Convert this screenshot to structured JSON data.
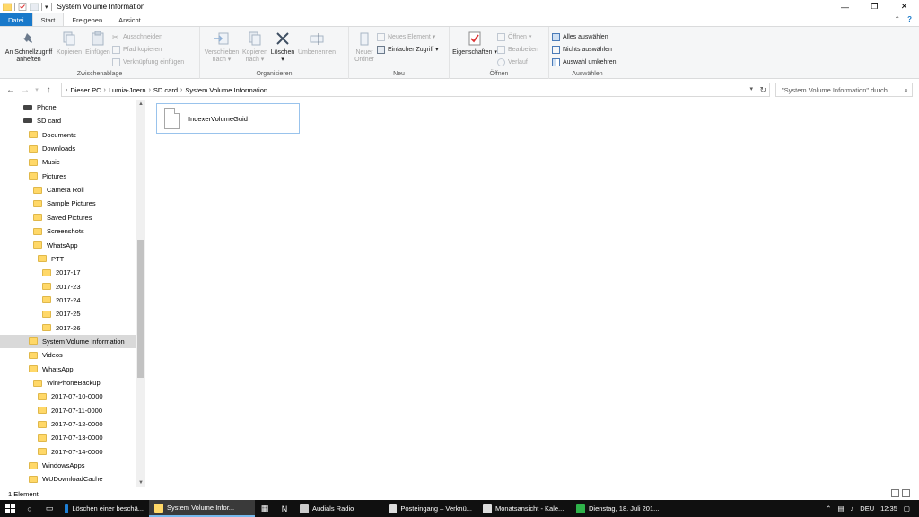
{
  "window": {
    "title": "System Volume Information",
    "min": "—",
    "max": "❐",
    "close": "✕"
  },
  "tabs": [
    "Datei",
    "Start",
    "Freigeben",
    "Ansicht"
  ],
  "ribbon": {
    "clipboard": {
      "pin": "An Schnellzugriff anheften",
      "copy": "Kopieren",
      "paste": "Einfügen",
      "cut": "Ausschneiden",
      "copy_path": "Pfad kopieren",
      "paste_shortcut": "Verknüpfung einfügen",
      "label": "Zwischenablage"
    },
    "organize": {
      "move": "Verschieben nach ▾",
      "copy_to": "Kopieren nach ▾",
      "delete": "Löschen ▾",
      "rename": "Umbenennen",
      "label": "Organisieren"
    },
    "new": {
      "new_folder": "Neuer Ordner",
      "new_item": "Neues Element ▾",
      "easy_access": "Einfacher Zugriff ▾",
      "label": "Neu"
    },
    "open": {
      "properties": "Eigenschaften ▾",
      "open": "Öffnen ▾",
      "edit": "Bearbeiten",
      "history": "Verlauf",
      "label": "Öffnen"
    },
    "select": {
      "select_all": "Alles auswählen",
      "select_none": "Nichts auswählen",
      "invert": "Auswahl umkehren",
      "label": "Auswählen"
    }
  },
  "address": {
    "crumbs": [
      "Dieser PC",
      "Lumia-Joern",
      "SD card",
      "System Volume Information"
    ],
    "search_placeholder": "\"System Volume Information\" durch..."
  },
  "nav": [
    {
      "label": "Phone",
      "type": "device",
      "indent": 26
    },
    {
      "label": "SD card",
      "type": "device",
      "indent": 26
    },
    {
      "label": "Documents",
      "type": "folder",
      "indent": 32
    },
    {
      "label": "Downloads",
      "type": "folder",
      "indent": 32
    },
    {
      "label": "Music",
      "type": "folder",
      "indent": 32
    },
    {
      "label": "Pictures",
      "type": "folder",
      "indent": 32
    },
    {
      "label": "Camera Roll",
      "type": "folder",
      "indent": 37
    },
    {
      "label": "Sample Pictures",
      "type": "folder",
      "indent": 37
    },
    {
      "label": "Saved Pictures",
      "type": "folder",
      "indent": 37
    },
    {
      "label": "Screenshots",
      "type": "folder",
      "indent": 37
    },
    {
      "label": "WhatsApp",
      "type": "folder",
      "indent": 37
    },
    {
      "label": "PTT",
      "type": "folder",
      "indent": 42
    },
    {
      "label": "2017-17",
      "type": "folder",
      "indent": 47
    },
    {
      "label": "2017-23",
      "type": "folder",
      "indent": 47
    },
    {
      "label": "2017-24",
      "type": "folder",
      "indent": 47
    },
    {
      "label": "2017-25",
      "type": "folder",
      "indent": 47
    },
    {
      "label": "2017-26",
      "type": "folder",
      "indent": 47
    },
    {
      "label": "System Volume Information",
      "type": "folder",
      "indent": 32,
      "selected": true
    },
    {
      "label": "Videos",
      "type": "folder",
      "indent": 32
    },
    {
      "label": "WhatsApp",
      "type": "folder",
      "indent": 32
    },
    {
      "label": "WinPhoneBackup",
      "type": "folder",
      "indent": 37
    },
    {
      "label": "2017-07-10-0000",
      "type": "folder",
      "indent": 42
    },
    {
      "label": "2017-07-11-0000",
      "type": "folder",
      "indent": 42
    },
    {
      "label": "2017-07-12-0000",
      "type": "folder",
      "indent": 42
    },
    {
      "label": "2017-07-13-0000",
      "type": "folder",
      "indent": 42
    },
    {
      "label": "2017-07-14-0000",
      "type": "folder",
      "indent": 42
    },
    {
      "label": "WindowsApps",
      "type": "folder",
      "indent": 32
    },
    {
      "label": "WUDownloadCache",
      "type": "folder",
      "indent": 32
    }
  ],
  "files": [
    {
      "name": "IndexerVolumeGuid"
    }
  ],
  "status": {
    "count": "1 Element"
  },
  "taskbar": {
    "apps": [
      {
        "label": "Löschen einer beschä...",
        "color": "#1e7fd6"
      },
      {
        "label": "System Volume Infor...",
        "color": "#ffd868",
        "active": true
      },
      {
        "label": "Audials Radio",
        "color": "#cccccc"
      },
      {
        "label": "Posteingang – Verknü...",
        "color": "#dddddd"
      },
      {
        "label": "Monatsansicht - Kale...",
        "color": "#dddddd"
      },
      {
        "label": "Dienstag, 18. Juli 201...",
        "color": "#2fb34a"
      }
    ],
    "lang": "DEU",
    "time": "12:35"
  },
  "colors": {
    "accent": "#1979ca",
    "folder": "#ffd868",
    "selection": "#d9d9d9"
  }
}
